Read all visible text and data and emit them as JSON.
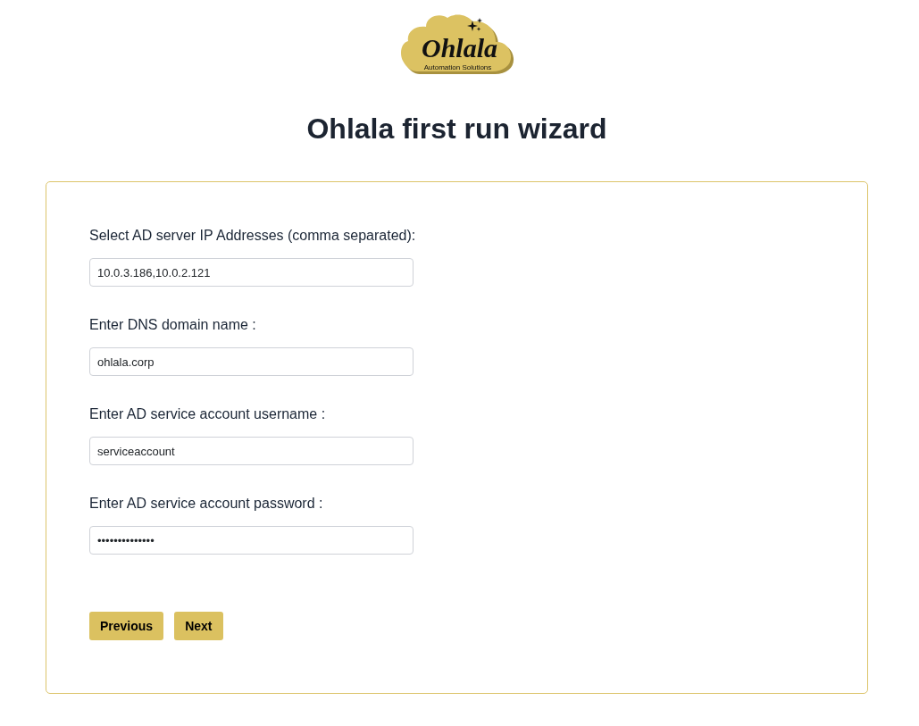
{
  "logo": {
    "name": "Ohlala",
    "tagline": "Automation Solutions"
  },
  "title": "Ohlala first run wizard",
  "fields": [
    {
      "label": "Select AD server IP Addresses (comma separated):",
      "value": "10.0.3.186,10.0.2.121"
    },
    {
      "label": "Enter DNS domain name :",
      "value": "ohlala.corp"
    },
    {
      "label": "Enter AD service account username :",
      "value": "serviceaccount"
    },
    {
      "label": "Enter AD service account password :",
      "value": "••••••••••••••"
    }
  ],
  "buttons": [
    {
      "label": "Previous"
    },
    {
      "label": "Next"
    }
  ]
}
